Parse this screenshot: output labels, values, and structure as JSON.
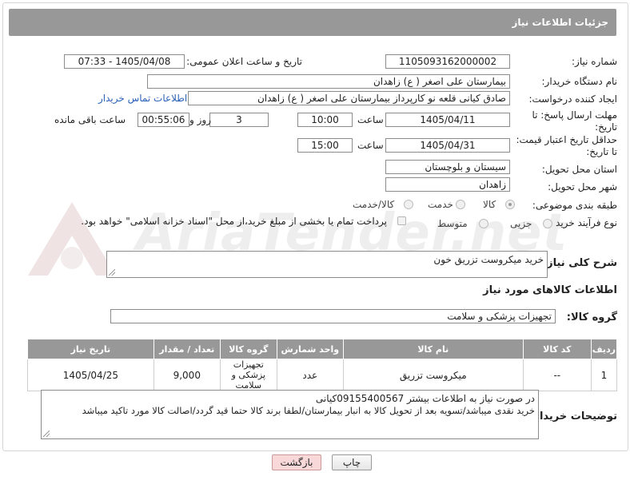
{
  "header": {
    "title": "جزئیات اطلاعات نیاز"
  },
  "watermark": "AriaTender.net",
  "need_number": {
    "label": "شماره نیاز:",
    "value": "1105093162000002"
  },
  "announce": {
    "label": "تاریخ و ساعت اعلان عمومی:",
    "value": "1405/04/08 - 07:33"
  },
  "buyer_org": {
    "label": "نام دستگاه خریدار:",
    "value": "بیمارستان علی اصغر ( ع) زاهدان"
  },
  "requester": {
    "label": "ایجاد کننده درخواست:",
    "value": "صادق کیانی قلعه نو کارپرداز بیمارستان علی اصغر ( ع) زاهدان",
    "contact_link": "اطلاعات تماس خریدار"
  },
  "reply_deadline": {
    "label": "مهلت ارسال پاسخ: تا تاریخ:",
    "date": "1405/04/11",
    "time_label": "ساعت",
    "time": "10:00",
    "days": "3",
    "days_label": "روز و",
    "remaining": "00:55:06",
    "remaining_label": "ساعت باقی مانده"
  },
  "price_validity": {
    "label": "حداقل تاریخ اعتبار قیمت: تا تاریخ:",
    "date": "1405/04/31",
    "time_label": "ساعت",
    "time": "15:00"
  },
  "province": {
    "label": "استان محل تحویل:",
    "value": "سیستان و بلوچستان"
  },
  "city": {
    "label": "شهر محل تحویل:",
    "value": "زاهدان"
  },
  "category": {
    "label": "طبقه بندی موضوعی:",
    "options": [
      "کالا",
      "خدمت",
      "کالا/خدمت"
    ],
    "selected": "کالا"
  },
  "purchase_process": {
    "label": "نوع فرآیند خرید :",
    "options": [
      "جزیی",
      "متوسط"
    ],
    "payment_note": "پرداخت تمام یا بخشی از مبلغ خرید،از محل \"اسناد خزانه اسلامی\" خواهد بود."
  },
  "general_desc": {
    "label": "شرح کلی نیاز:",
    "value": "خرید میکروست تزریق خون"
  },
  "goods_info": {
    "label": "اطلاعات کالاهای مورد نیاز"
  },
  "goods_group": {
    "label": "گروه کالا:",
    "value": "تجهیزات پزشکی و سلامت"
  },
  "table": {
    "headers": [
      "ردیف",
      "کد کالا",
      "نام کالا",
      "واحد شمارش",
      "گروه کالا",
      "تعداد / مقدار",
      "تاریخ نیاز"
    ],
    "rows": [
      [
        "1",
        "--",
        "میکروست تزریق",
        "عدد",
        "تجهیزات پزشکی و سلامت",
        "9,000",
        "1405/04/25"
      ]
    ]
  },
  "buyer_notes": {
    "label": "توضیحات خریدار:",
    "line1": "در صورت نیاز به اطلاعات بیشتر 09155400567کیانی",
    "line2": "خرید نقدی میباشد/تسویه بعد از تحویل کالا به انبار بیمارستان/لطفا برند کالا حتما قید گردد/اصالت کالا مورد تاکید میباشد"
  },
  "buttons": {
    "print": "چاپ",
    "back": "بازگشت"
  }
}
